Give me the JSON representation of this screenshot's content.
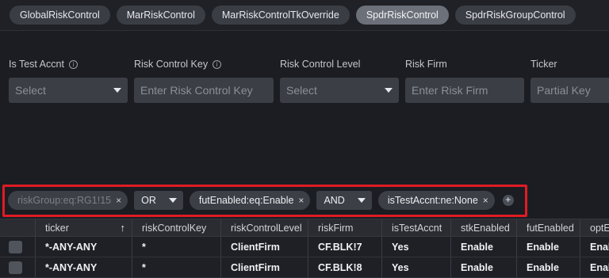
{
  "tabs": [
    {
      "label": "GlobalRiskControl",
      "active": false
    },
    {
      "label": "MarRiskControl",
      "active": false
    },
    {
      "label": "MarRiskControlTkOverride",
      "active": false
    },
    {
      "label": "SpdrRiskControl",
      "active": true
    },
    {
      "label": "SpdrRiskGroupControl",
      "active": false
    }
  ],
  "filters": {
    "is_test_accnt": {
      "label": "Is Test Accnt",
      "value": "Select"
    },
    "risk_control_key": {
      "label": "Risk Control Key",
      "placeholder": "Enter Risk Control Key"
    },
    "risk_control_level": {
      "label": "Risk Control Level",
      "value": "Select"
    },
    "risk_firm": {
      "label": "Risk Firm",
      "placeholder": "Enter Risk Firm"
    },
    "ticker": {
      "label": "Ticker",
      "placeholder": "Partial Key"
    }
  },
  "chips": {
    "chip1": "riskGroup:eq:RG1!15",
    "op1": "OR",
    "chip2": "futEnabled:eq:Enable",
    "op2": "AND",
    "chip3": "isTestAccnt:ne:None",
    "add": "+",
    "remove": "×"
  },
  "grid": {
    "columns": [
      "ticker",
      "riskControlKey",
      "riskControlLevel",
      "riskFirm",
      "isTestAccnt",
      "stkEnabled",
      "futEnabled",
      "optE"
    ],
    "sort_icon": "↑",
    "rows": [
      [
        "*-ANY-ANY",
        "*",
        "ClientFirm",
        "CF.BLK!7",
        "Yes",
        "Enable",
        "Enable",
        "Enab"
      ],
      [
        "*-ANY-ANY",
        "*",
        "ClientFirm",
        "CF.BLK!8",
        "Yes",
        "Enable",
        "Enable",
        "Enab"
      ]
    ]
  },
  "colors": {
    "background": "#1b1d22",
    "highlight_outline": "#e01b24",
    "active_tab": "#6b7079"
  }
}
